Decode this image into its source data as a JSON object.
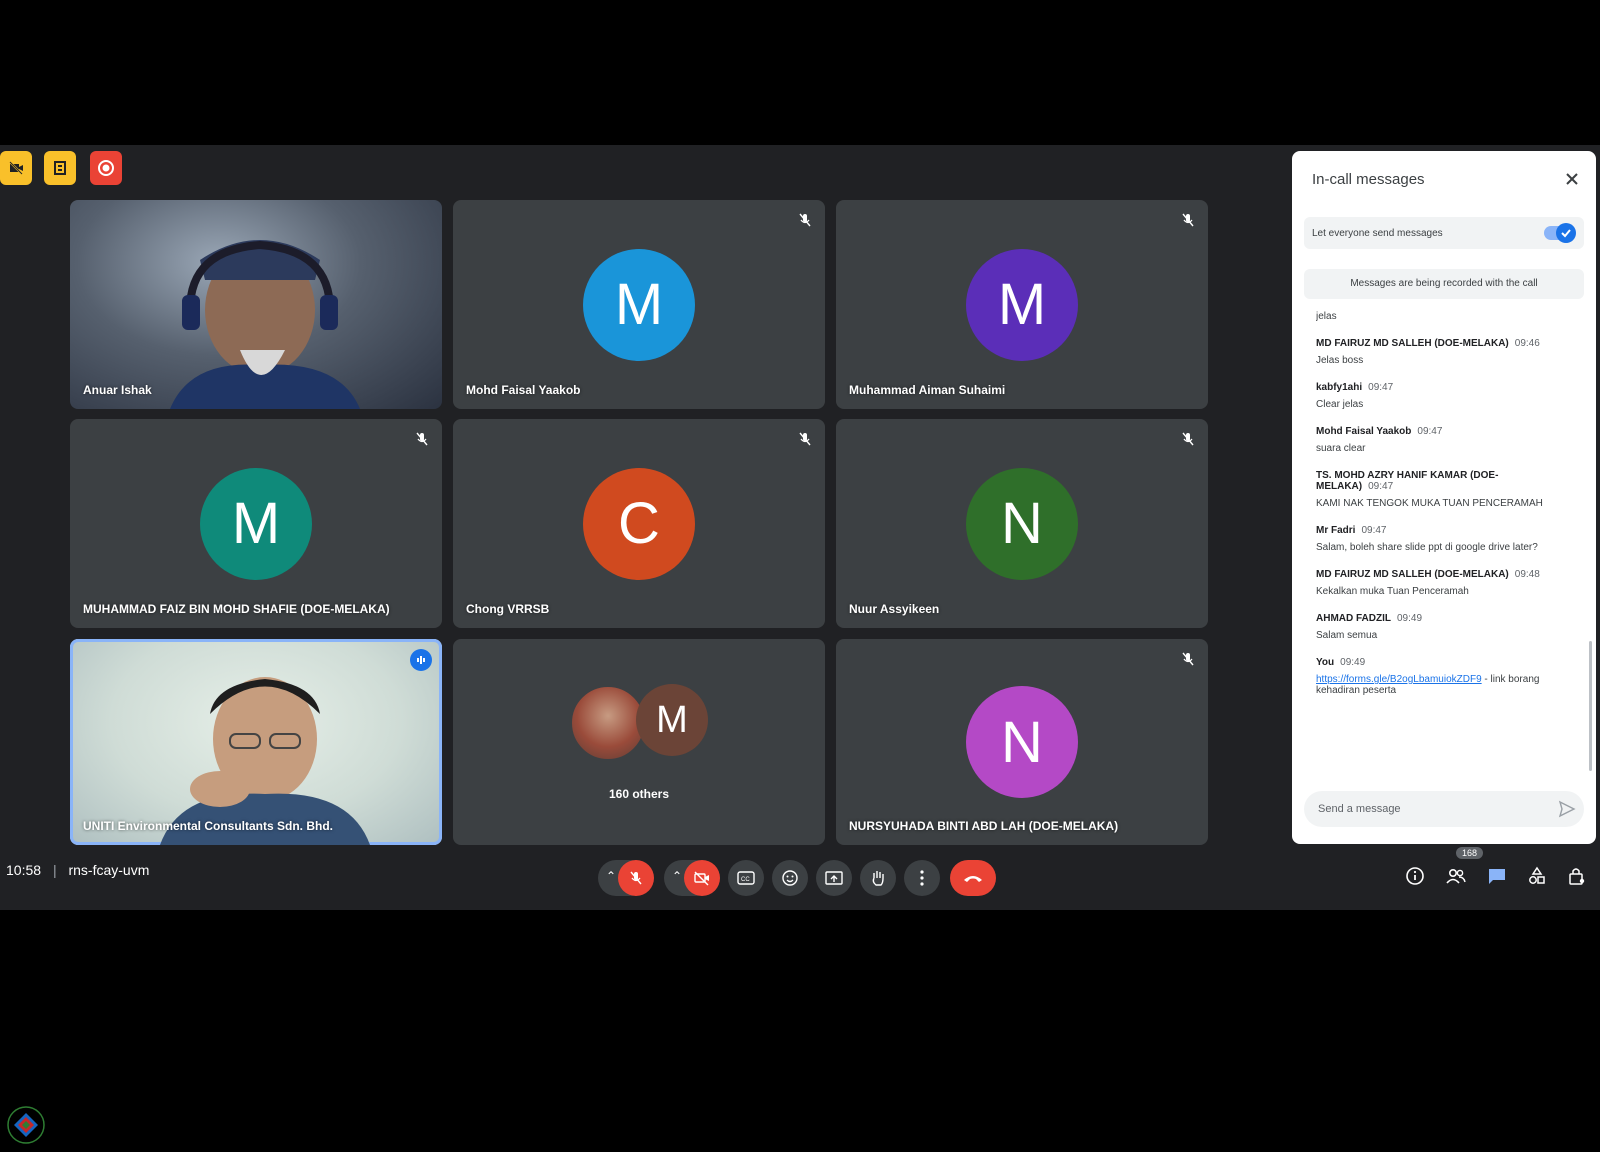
{
  "participants": [
    {
      "name": "Anuar Ishak",
      "type": "video"
    },
    {
      "name": "Mohd Faisal Yaakob",
      "initial": "M",
      "color": "#1a95d9"
    },
    {
      "name": "Muhammad Aiman Suhaimi",
      "initial": "M",
      "color": "#5b2eb8"
    },
    {
      "name": "MUHAMMAD FAIZ BIN MOHD SHAFIE (DOE-MELAKA)",
      "initial": "M",
      "color": "#0f8a7a"
    },
    {
      "name": "Chong VRRSB",
      "initial": "C",
      "color": "#d04a1f"
    },
    {
      "name": "Nuur Assyikeen",
      "initial": "N",
      "color": "#2f6f2a"
    },
    {
      "name": "UNITI Environmental Consultants Sdn. Bhd.",
      "type": "video"
    },
    {
      "name": "160 others",
      "initial": "M",
      "color": "#6b4437"
    },
    {
      "name": "NURSYUHADA BINTI ABD LAH (DOE-MELAKA)",
      "initial": "N",
      "color": "#b449c6"
    }
  ],
  "chat": {
    "title": "In-call messages",
    "toggle_label": "Let everyone send messages",
    "notice": "Messages are being recorded with the call",
    "messages": [
      {
        "sender": "",
        "time": "",
        "body": "jelas"
      },
      {
        "sender": "MD FAIRUZ MD SALLEH (DOE-MELAKA)",
        "time": "09:46",
        "body": "Jelas boss"
      },
      {
        "sender": "kabfy1ahi",
        "time": "09:47",
        "body": "Clear jelas"
      },
      {
        "sender": "Mohd Faisal Yaakob",
        "time": "09:47",
        "body": "suara clear"
      },
      {
        "sender": "TS. MOHD AZRY HANIF KAMAR (DOE-MELAKA)",
        "time": "09:47",
        "body": "KAMI NAK TENGOK MUKA TUAN PENCERAMAH"
      },
      {
        "sender": "Mr Fadri",
        "time": "09:47",
        "body": "Salam, boleh share slide ppt di google drive later?"
      },
      {
        "sender": "MD FAIRUZ MD SALLEH (DOE-MELAKA)",
        "time": "09:48",
        "body": "Kekalkan muka Tuan Penceramah"
      },
      {
        "sender": "AHMAD FADZIL",
        "time": "09:49",
        "body": "Salam semua"
      }
    ],
    "last_message": {
      "sender": "You",
      "time": "09:49",
      "link": "https://forms.gle/B2ogLbamuiokZDF9",
      "suffix": " - link borang kehadiran peserta"
    },
    "input_placeholder": "Send a message"
  },
  "bottom": {
    "time": "10:58",
    "separator": "|",
    "meeting_code": "rns-fcay-uvm",
    "participant_count": "168"
  },
  "colors": {
    "background": "#202124",
    "tile": "#3c4043",
    "red": "#ea4335",
    "blue": "#1a73e8",
    "yellow": "#f9c02a"
  }
}
